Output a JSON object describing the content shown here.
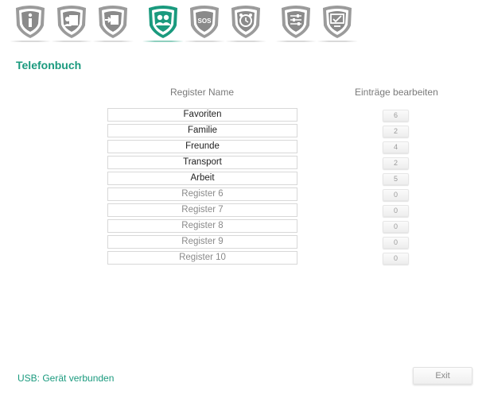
{
  "toolbar": {
    "items": [
      {
        "icon": "info-icon",
        "active": false
      },
      {
        "icon": "contact-card-icon",
        "active": false
      },
      {
        "icon": "sim-transfer-icon",
        "active": false
      },
      {
        "icon": "phonebook-icon",
        "active": true
      },
      {
        "icon": "sos-icon",
        "active": false
      },
      {
        "icon": "alarm-clock-icon",
        "active": false
      },
      {
        "icon": "settings-sliders-icon",
        "active": false
      },
      {
        "icon": "monitor-check-icon",
        "active": false
      }
    ],
    "sos_text": "SOS"
  },
  "page": {
    "title": "Telefonbuch",
    "col_name_header": "Register Name",
    "col_edit_header": "Einträge bearbeiten"
  },
  "registers": [
    {
      "name": "Favoriten",
      "count": "6",
      "custom": true
    },
    {
      "name": "Familie",
      "count": "2",
      "custom": true
    },
    {
      "name": "Freunde",
      "count": "4",
      "custom": true
    },
    {
      "name": "Transport",
      "count": "2",
      "custom": true
    },
    {
      "name": "Arbeit",
      "count": "5",
      "custom": true
    },
    {
      "name": "Register 6",
      "count": "0",
      "custom": false
    },
    {
      "name": "Register 7",
      "count": "0",
      "custom": false
    },
    {
      "name": "Register 8",
      "count": "0",
      "custom": false
    },
    {
      "name": "Register 9",
      "count": "0",
      "custom": false
    },
    {
      "name": "Register 10",
      "count": "0",
      "custom": false
    }
  ],
  "footer": {
    "status": "USB: Gerät verbunden",
    "exit_label": "Exit"
  },
  "colors": {
    "accent": "#1a9a7e",
    "icon_gray": "#9b9b9b"
  }
}
